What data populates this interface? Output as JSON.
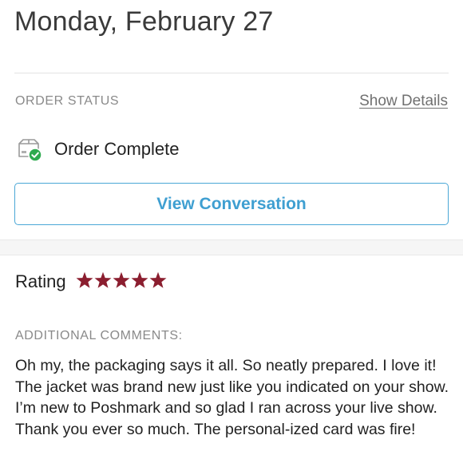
{
  "header": {
    "date": "Monday, February 27"
  },
  "order": {
    "status_label": "ORDER STATUS",
    "show_details_label": "Show Details",
    "status_text": "Order Complete",
    "status_icon": "package-check-icon",
    "view_conversation_label": "View Conversation"
  },
  "rating": {
    "label": "Rating",
    "stars": 5,
    "max_stars": 5,
    "star_icon": "star-icon"
  },
  "comments": {
    "label": "ADDITIONAL COMMENTS:",
    "text": "Oh my, the packaging says it all. So neatly prepared. I love it! The jacket was brand new just like you indicated on your show. I’m new to Poshmark and so glad I ran across your live show. Thank you ever so much. The personal-ized card was fire!"
  },
  "colors": {
    "accent": "#3f9fd1",
    "star": "#8b1e2f",
    "success": "#2eaa4f",
    "muted": "#8a8a8a"
  }
}
